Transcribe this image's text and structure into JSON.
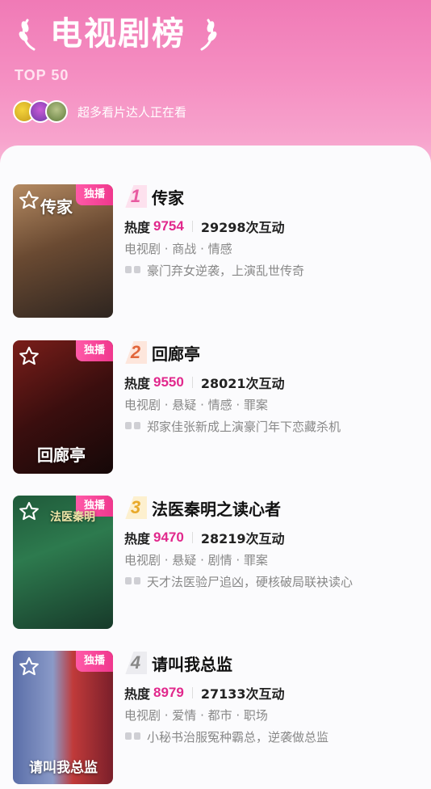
{
  "header": {
    "title": "电视剧榜",
    "subtitle": "TOP 50",
    "viewers_text": "超多看片达人正在看"
  },
  "colors": {
    "accent": "#e1288c",
    "rank1": "#e85aa0",
    "rank2": "#e2663b",
    "rank3": "#e8a92a",
    "rank4": "#888888"
  },
  "items": [
    {
      "rank": "1",
      "name": "传家",
      "badge": "独播",
      "heat_label": "热度",
      "heat_value": "9754",
      "interactions": "29298次互动",
      "tags": "电视剧 · 商战 · 情感",
      "quote": "豪门弃女逆袭，上演乱世传奇",
      "poster_caption": "传家"
    },
    {
      "rank": "2",
      "name": "回廊亭",
      "badge": "独播",
      "heat_label": "热度",
      "heat_value": "9550",
      "interactions": "28021次互动",
      "tags": "电视剧 · 悬疑 · 情感 · 罪案",
      "quote": "郑家佳张新成上演豪门年下恋藏杀机",
      "poster_caption": "回廊亭"
    },
    {
      "rank": "3",
      "name": "法医秦明之读心者",
      "badge": "独播",
      "heat_label": "热度",
      "heat_value": "9470",
      "interactions": "28219次互动",
      "tags": "电视剧 · 悬疑 · 剧情 · 罪案",
      "quote": "天才法医验尸追凶，硬核破局联袂读心",
      "poster_caption": "法医秦明"
    },
    {
      "rank": "4",
      "name": "请叫我总监",
      "badge": "独播",
      "heat_label": "热度",
      "heat_value": "8979",
      "interactions": "27133次互动",
      "tags": "电视剧 · 爱情 · 都市 · 职场",
      "quote": "小秘书治服冤种霸总，逆袭做总监",
      "poster_caption": "请叫我总监"
    }
  ]
}
